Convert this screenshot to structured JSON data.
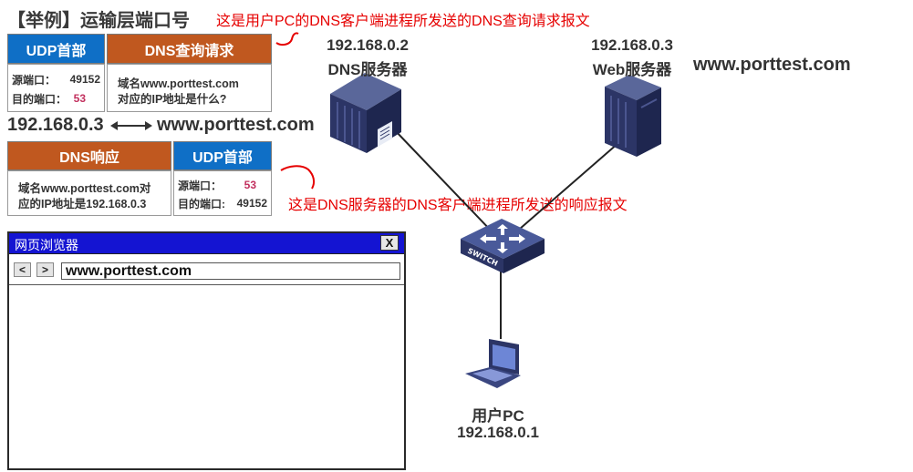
{
  "slide": {
    "title": "【举例】运输层端口号",
    "query_note": "这是用户PC的DNS客户端进程所发送的DNS查询请求报文",
    "response_note": "这是DNS服务器的DNS客户端进程所发送的响应报文"
  },
  "query_packet": {
    "udp_header_label": "UDP首部",
    "dns_label": "DNS查询请求",
    "src_port_label": "源端口：",
    "src_port": "49152",
    "dst_port_label": "目的端口：",
    "dst_port": "53",
    "body_line1": "域名www.porttest.com",
    "body_line2": "对应的IP地址是什么?"
  },
  "mapping": {
    "ip": "192.168.0.3",
    "domain": "www.porttest.com"
  },
  "response_packet": {
    "dns_label": "DNS响应",
    "udp_header_label": "UDP首部",
    "body_line1": "域名www.porttest.com对",
    "body_line2": "应的IP地址是192.168.0.3",
    "src_port_label": "源端口：",
    "src_port": "53",
    "dst_port_label": "目的端口:",
    "dst_port": "49152"
  },
  "browser": {
    "title": "网页浏览器",
    "close_label": "X",
    "back_label": "<",
    "forward_label": ">",
    "address": "www.porttest.com"
  },
  "network": {
    "dns_server": {
      "ip": "192.168.0.2",
      "name": "DNS服务器",
      "icon": "server-icon"
    },
    "web_server": {
      "ip": "192.168.0.3",
      "name": "Web服务器",
      "domain": "www.porttest.com",
      "icon": "server-icon"
    },
    "switch": {
      "label": "SWITCH",
      "icon": "switch-icon"
    },
    "user_pc": {
      "name": "用户PC",
      "ip": "192.168.0.1",
      "icon": "laptop-icon"
    }
  },
  "colors": {
    "udp_blue": "#0f6fc6",
    "dns_orange": "#c0581f",
    "annotation_red": "#e60000",
    "port_highlight": "#c2305e",
    "browser_titlebar": "#1414d2",
    "device_navy": "#2c3566"
  }
}
